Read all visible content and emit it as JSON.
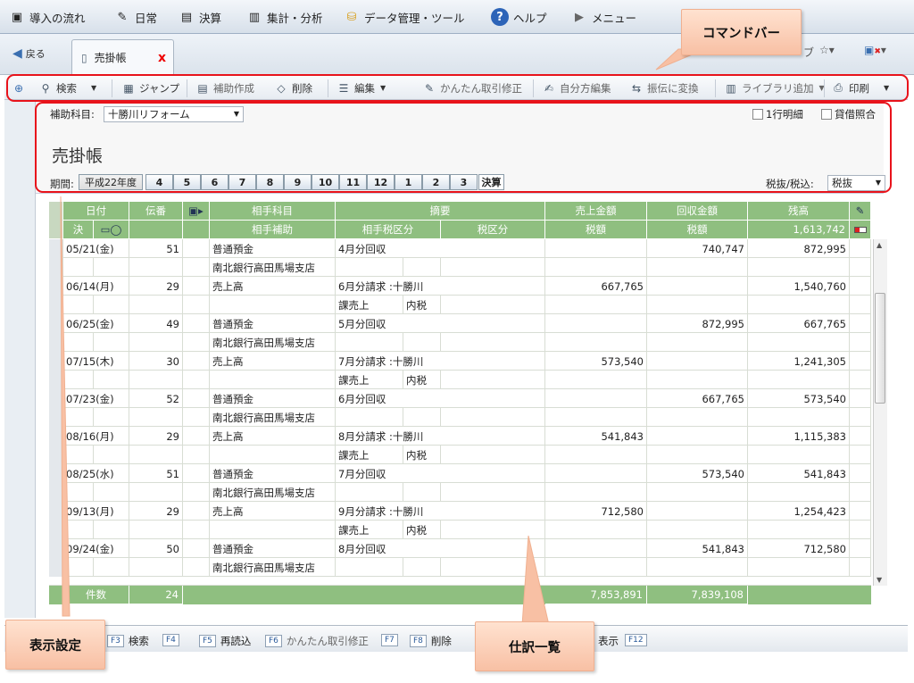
{
  "menu": [
    {
      "icon": "flow-icon",
      "label": "導入の流れ"
    },
    {
      "icon": "pen-icon",
      "label": "日常"
    },
    {
      "icon": "book-icon",
      "label": "決算"
    },
    {
      "icon": "chart-icon",
      "label": "集計・分析"
    },
    {
      "icon": "database-icon",
      "label": "データ管理・ツール"
    },
    {
      "icon": "help-icon",
      "label": "ヘルプ"
    },
    {
      "icon": "play-icon",
      "label": "メニュー"
    }
  ],
  "nav": {
    "back": "戻る",
    "tab": "売掛帳",
    "tab_close": "x",
    "partial": "ブ"
  },
  "cmd": {
    "search": "検索",
    "jump": "ジャンプ",
    "aux": "補助作成",
    "del": "削除",
    "edit": "編集",
    "easy": "かんたん取引修正",
    "self": "自分方編集",
    "convert": "振伝に変換",
    "library": "ライブラリ追加",
    "print": "印刷"
  },
  "form": {
    "sub_label": "補助科目:",
    "sub_value": "十勝川リフォーム",
    "one_line": "1行明細",
    "taishaku": "貸借照合",
    "title": "売掛帳",
    "period_label": "期間:",
    "year": "平成22年度",
    "months": [
      "4",
      "5",
      "6",
      "7",
      "8",
      "9",
      "10",
      "11",
      "12",
      "1",
      "2",
      "3"
    ],
    "kessan": "決算",
    "tax_label": "税抜/税込:",
    "tax_value": "税抜"
  },
  "grid": {
    "h1": [
      "日付",
      "伝番",
      "",
      "相手科目",
      "摘要",
      "売上金額",
      "回収金額",
      "残高"
    ],
    "h2": [
      "決",
      "",
      "",
      "相手補助",
      "相手税区分",
      "税区分",
      "税額",
      "税額",
      "1,613,742"
    ]
  },
  "rows": [
    {
      "date": "05/21(金)",
      "no": "51",
      "acct": "普通預金",
      "memo": "4月分回収",
      "sales": "",
      "coll": "740,747",
      "bal": "872,995",
      "sub": "南北銀行高田馬場支店",
      "taxc": "",
      "taxk": ""
    },
    {
      "date": "06/14(月)",
      "no": "29",
      "acct": "売上高",
      "memo": "6月分請求 :十勝川",
      "sales": "667,765",
      "coll": "",
      "bal": "1,540,760",
      "sub": "",
      "taxc": "課売上",
      "taxk": "内税"
    },
    {
      "date": "06/25(金)",
      "no": "49",
      "acct": "普通預金",
      "memo": "5月分回収",
      "sales": "",
      "coll": "872,995",
      "bal": "667,765",
      "sub": "南北銀行高田馬場支店",
      "taxc": "",
      "taxk": ""
    },
    {
      "date": "07/15(木)",
      "no": "30",
      "acct": "売上高",
      "memo": "7月分請求 :十勝川",
      "sales": "573,540",
      "coll": "",
      "bal": "1,241,305",
      "sub": "",
      "taxc": "課売上",
      "taxk": "内税"
    },
    {
      "date": "07/23(金)",
      "no": "52",
      "acct": "普通預金",
      "memo": "6月分回収",
      "sales": "",
      "coll": "667,765",
      "bal": "573,540",
      "sub": "南北銀行高田馬場支店",
      "taxc": "",
      "taxk": ""
    },
    {
      "date": "08/16(月)",
      "no": "29",
      "acct": "売上高",
      "memo": "8月分請求 :十勝川",
      "sales": "541,843",
      "coll": "",
      "bal": "1,115,383",
      "sub": "",
      "taxc": "課売上",
      "taxk": "内税"
    },
    {
      "date": "08/25(水)",
      "no": "51",
      "acct": "普通預金",
      "memo": "7月分回収",
      "sales": "",
      "coll": "573,540",
      "bal": "541,843",
      "sub": "南北銀行高田馬場支店",
      "taxc": "",
      "taxk": ""
    },
    {
      "date": "09/13(月)",
      "no": "29",
      "acct": "売上高",
      "memo": "9月分請求 :十勝川",
      "sales": "712,580",
      "coll": "",
      "bal": "1,254,423",
      "sub": "",
      "taxc": "課売上",
      "taxk": "内税"
    },
    {
      "date": "09/24(金)",
      "no": "50",
      "acct": "普通預金",
      "memo": "8月分回収",
      "sales": "",
      "coll": "541,843",
      "bal": "712,580",
      "sub": "南北銀行高田馬場支店",
      "taxc": "",
      "taxk": ""
    }
  ],
  "total": {
    "label": "件数",
    "count": "24",
    "sales": "7,853,891",
    "coll": "7,839,108"
  },
  "fkeys": [
    {
      "k": "F3",
      "t": "検索"
    },
    {
      "k": "F4",
      "t": ""
    },
    {
      "k": "F5",
      "t": "再読込"
    },
    {
      "k": "F6",
      "t": "かんたん取引修正"
    },
    {
      "k": "F7",
      "t": ""
    },
    {
      "k": "F8",
      "t": "削除"
    },
    {
      "k": "",
      "t": "表示"
    },
    {
      "k": "F12",
      "t": ""
    }
  ],
  "callouts": {
    "command": "コマンドバー",
    "display": "表示設定",
    "journal": "仕訳一覧"
  },
  "colors": {
    "accent_red": "#e8131b",
    "grid_green": "#8fbf80",
    "row_green": "#e7f3e2",
    "callout": "#f8c0a4"
  }
}
